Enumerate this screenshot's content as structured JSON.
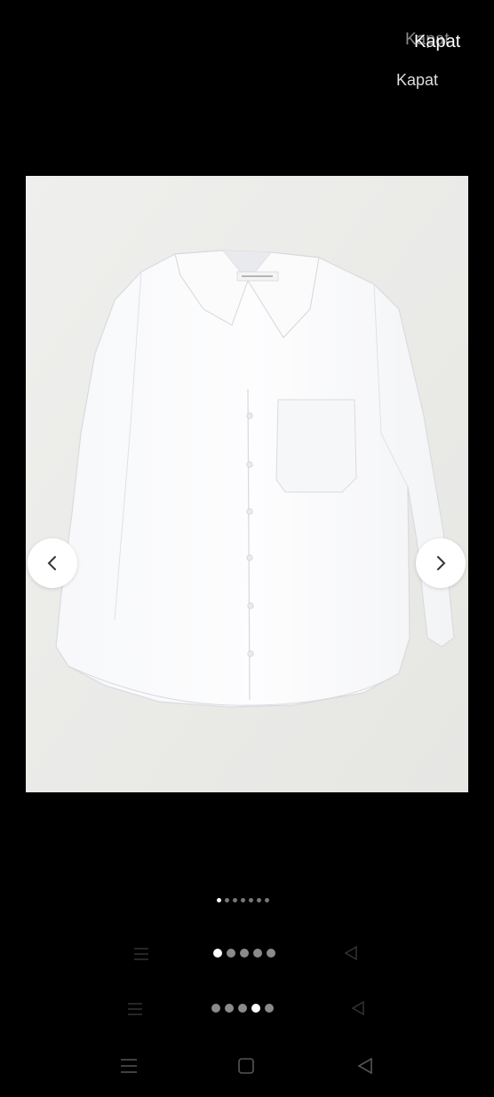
{
  "header": {
    "close_label": "Kapat",
    "close_label_ghost_a": "Kapat",
    "close_label_ghost_b": "Kapat"
  },
  "gallery": {
    "total_images": 7,
    "current_index": 1,
    "prev_icon": "chevron-left-icon",
    "next_icon": "chevron-right-icon",
    "image_subject": "white-shirt"
  },
  "ghost_rows": [
    {
      "dots": 5,
      "active": 1
    },
    {
      "dots": 5,
      "active": 4
    }
  ],
  "system_nav": {
    "recents_icon": "menu-lines-icon",
    "home_icon": "square-home-icon",
    "back_icon": "triangle-back-icon"
  },
  "colors": {
    "background": "#000000",
    "viewer_bg": "#ececea",
    "active_dot": "#ffffff",
    "inactive_dot": "#777777"
  }
}
